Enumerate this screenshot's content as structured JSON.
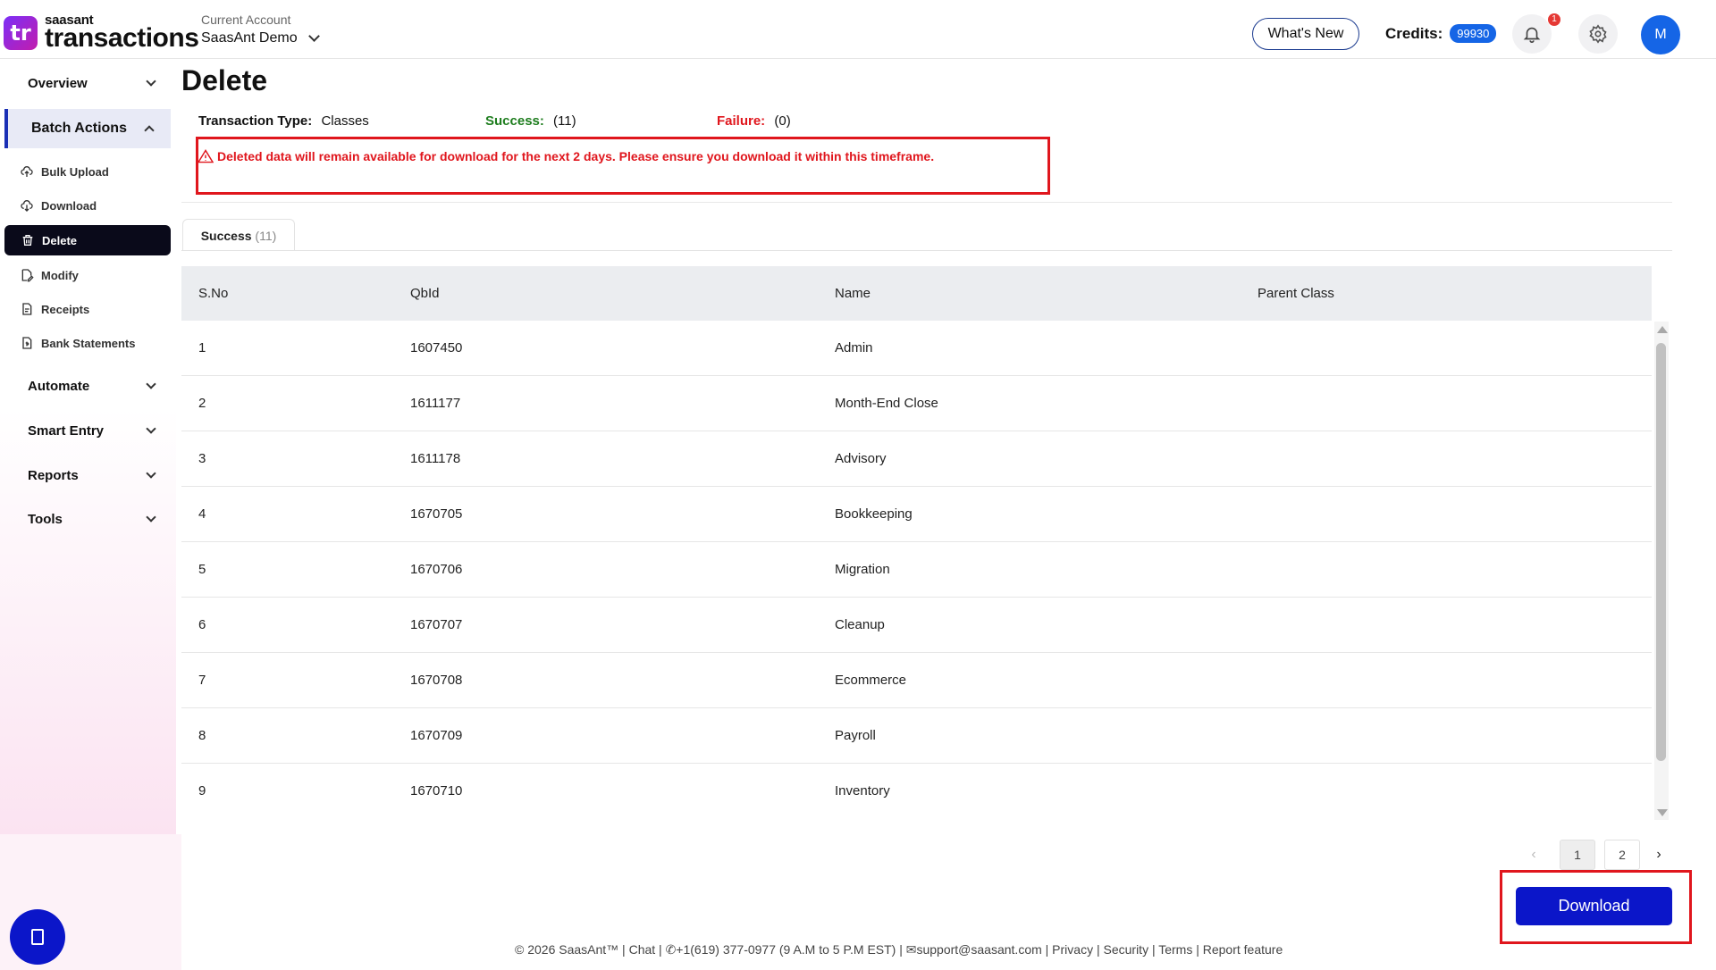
{
  "header": {
    "logo_mark": "tr",
    "logo_small": "saasant",
    "logo_big": "transactions",
    "account_label": "Current Account",
    "account_name": "SaasAnt Demo",
    "whats_new": "What's New",
    "credits_label": "Credits:",
    "credits_value": "99930",
    "notification_count": "1",
    "avatar_initial": "M"
  },
  "sidebar": {
    "overview": "Overview",
    "batch_actions": "Batch Actions",
    "sub_items": [
      {
        "label": "Bulk Upload",
        "icon": "cloud-upload-icon"
      },
      {
        "label": "Download",
        "icon": "cloud-download-icon"
      },
      {
        "label": "Delete",
        "icon": "trash-icon"
      },
      {
        "label": "Modify",
        "icon": "edit-file-icon"
      },
      {
        "label": "Receipts",
        "icon": "receipt-icon"
      },
      {
        "label": "Bank Statements",
        "icon": "statement-icon"
      }
    ],
    "automate": "Automate",
    "smart_entry": "Smart Entry",
    "reports": "Reports",
    "tools": "Tools"
  },
  "page": {
    "title": "Delete",
    "transaction_type_label": "Transaction Type:",
    "transaction_type_value": "Classes",
    "success_label": "Success:",
    "success_value": "(11)",
    "failure_label": "Failure:",
    "failure_value": "(0)",
    "warning": "Deleted data will remain available for download for the next 2 days. Please ensure you download it within this timeframe.",
    "tab_label": "Success",
    "tab_count": "(11)",
    "success_color": "#1e7d1e",
    "failure_color": "#e0161d"
  },
  "table": {
    "columns": [
      "S.No",
      "QbId",
      "Name",
      "Parent Class"
    ],
    "rows": [
      [
        "1",
        "1607450",
        "Admin",
        ""
      ],
      [
        "2",
        "1611177",
        "Month-End Close",
        ""
      ],
      [
        "3",
        "1611178",
        "Advisory",
        ""
      ],
      [
        "4",
        "1670705",
        "Bookkeeping",
        ""
      ],
      [
        "5",
        "1670706",
        "Migration",
        ""
      ],
      [
        "6",
        "1670707",
        "Cleanup",
        ""
      ],
      [
        "7",
        "1670708",
        "Ecommerce",
        ""
      ],
      [
        "8",
        "1670709",
        "Payroll",
        ""
      ],
      [
        "9",
        "1670710",
        "Inventory",
        ""
      ]
    ]
  },
  "pagination": {
    "prev": "‹",
    "pages": [
      "1",
      "2"
    ],
    "current": "1",
    "next": "›"
  },
  "download_button": "Download",
  "footer": "© 2026 SaasAnt™ | Chat | ✆+1(619) 377-0977 (9 A.M to 5 P.M EST) | ✉support@saasant.com | Privacy | Security | Terms | Report feature"
}
